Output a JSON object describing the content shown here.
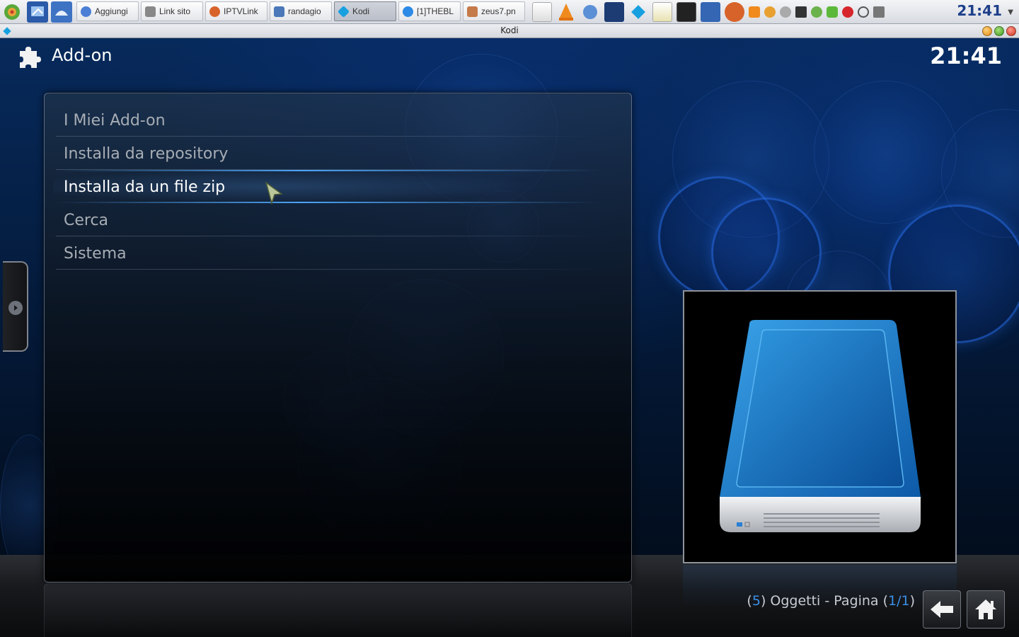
{
  "taskbar": {
    "tasks": [
      {
        "label": "Aggiungi",
        "color": "#4b7fd6"
      },
      {
        "label": "Link sito",
        "color": "#888888"
      },
      {
        "label": "IPTVLink",
        "color": "#d8632a"
      },
      {
        "label": "randagio",
        "color": "#4a78b8"
      },
      {
        "label": "Kodi",
        "color": "#17a0e0"
      },
      {
        "label": "[1]THEBL",
        "color": "#2d8ae6"
      },
      {
        "label": "zeus7.pn",
        "color": "#c57a4a"
      }
    ],
    "clock": "21:41"
  },
  "window": {
    "title": "Kodi"
  },
  "kodi": {
    "header_title": "Add-on",
    "clock": "21:41",
    "menu": [
      {
        "label": "I Miei Add-on"
      },
      {
        "label": "Installa da repository"
      },
      {
        "label": "Installa da un file zip",
        "selected": true
      },
      {
        "label": "Cerca"
      },
      {
        "label": "Sistema"
      }
    ],
    "footer": {
      "open_paren": "(",
      "count": "5",
      "items_text": ") Oggetti - Pagina (",
      "page": "1/1",
      "close_paren": ")"
    },
    "icons": {
      "header": "puzzle-icon",
      "thumbnail": "hard-drive-icon",
      "back": "back-arrow-icon",
      "home": "home-icon"
    },
    "colors": {
      "accent": "#3b8fe8",
      "selection": "#50aaff"
    }
  }
}
